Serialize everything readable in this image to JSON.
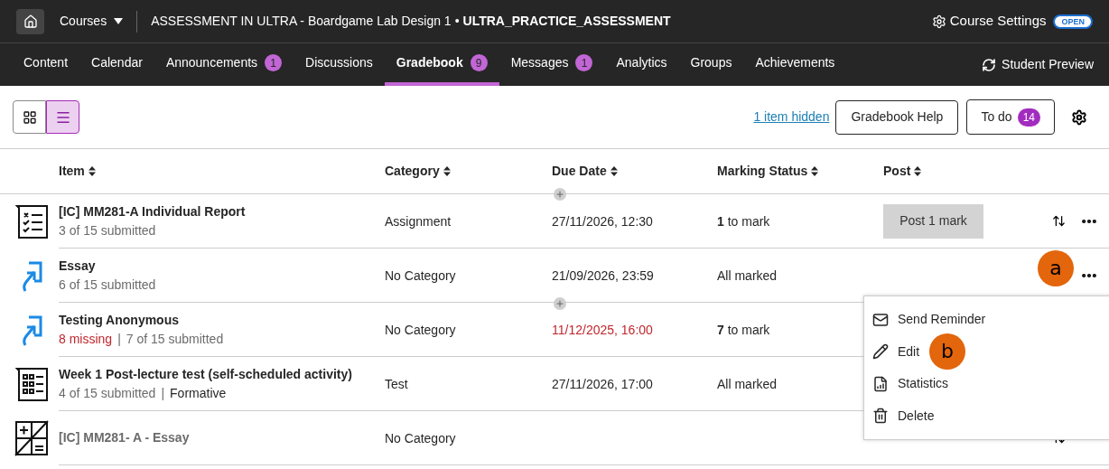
{
  "topbar": {
    "courses_label": "Courses",
    "course_title": "ASSESSMENT IN ULTRA - Boardgame Lab Design 1",
    "course_code": "ULTRA_PRACTICE_ASSESSMENT",
    "separator": "•",
    "settings_label": "Course Settings",
    "status_badge": "OPEN"
  },
  "tabs": [
    {
      "label": "Content",
      "selected": false
    },
    {
      "label": "Calendar",
      "selected": false
    },
    {
      "label": "Announcements",
      "badge": "1",
      "selected": false
    },
    {
      "label": "Discussions",
      "selected": false
    },
    {
      "label": "Gradebook",
      "badge": "9",
      "selected": true
    },
    {
      "label": "Messages",
      "badge": "1",
      "selected": false
    },
    {
      "label": "Analytics",
      "selected": false
    },
    {
      "label": "Groups",
      "selected": false
    },
    {
      "label": "Achievements",
      "selected": false
    }
  ],
  "student_preview": "Student Preview",
  "toolbar": {
    "views": [
      {
        "kind": "grid",
        "selected": false
      },
      {
        "kind": "list",
        "selected": true
      }
    ],
    "hidden_link": "1 item hidden",
    "help_button": "Gradebook Help",
    "todo_button": "To do",
    "todo_count": "14"
  },
  "table": {
    "columns": [
      "Item",
      "Category",
      "Due Date",
      "Marking Status",
      "Post"
    ],
    "rows": [
      {
        "kind": "checklist",
        "title": "[IC] MM281-A Individual Report",
        "dimmed": false,
        "subtitle": [
          {
            "kind": "normal",
            "text": "3 of 15 submitted"
          }
        ],
        "category": "Assignment",
        "due": "27/11/2026, 12:30",
        "overdue": false,
        "marking": "**1** to mark",
        "post_button": "Post 1 mark",
        "reorder": true,
        "more": true
      },
      {
        "kind": "upload",
        "title": "Essay",
        "dimmed": false,
        "subtitle": [
          {
            "kind": "normal",
            "text": "6 of 15 submitted"
          }
        ],
        "category": "No Category",
        "due": "21/09/2026, 23:59",
        "overdue": false,
        "marking": "All marked",
        "reorder": false,
        "more": true
      },
      {
        "kind": "upload",
        "title": "Testing Anonymous",
        "dimmed": false,
        "subtitle": [
          {
            "kind": "missing",
            "text": "8 missing"
          },
          {
            "kind": "separator",
            "text": "|"
          },
          {
            "kind": "normal",
            "text": "7 of 15 submitted"
          }
        ],
        "category": "No Category",
        "due": "11/12/2025, 16:00",
        "overdue": true,
        "marking": "**7** to mark",
        "reorder": false,
        "more": false
      },
      {
        "kind": "test",
        "title": "Week 1 Post-lecture test (self-scheduled activity)",
        "dimmed": false,
        "subtitle": [
          {
            "kind": "normal",
            "text": "4 of 15 submitted"
          },
          {
            "kind": "separator",
            "text": "|"
          },
          {
            "kind": "tag",
            "text": "Formative"
          }
        ],
        "category": "Test",
        "due": "27/11/2026, 17:00",
        "overdue": false,
        "marking": "All marked",
        "reorder": false,
        "more": false
      },
      {
        "kind": "calculation",
        "title": "[IC] MM281- A - Essay",
        "dimmed": true,
        "subtitle": [],
        "category": "No Category",
        "reorder": true,
        "more": false
      }
    ]
  },
  "menu": [
    {
      "kind": "mail",
      "label": "Send Reminder"
    },
    {
      "kind": "edit",
      "label": "Edit"
    },
    {
      "kind": "statistics",
      "label": "Statistics"
    },
    {
      "kind": "delete",
      "label": "Delete"
    }
  ],
  "callouts": [
    {
      "label": "a"
    },
    {
      "label": "b"
    }
  ]
}
